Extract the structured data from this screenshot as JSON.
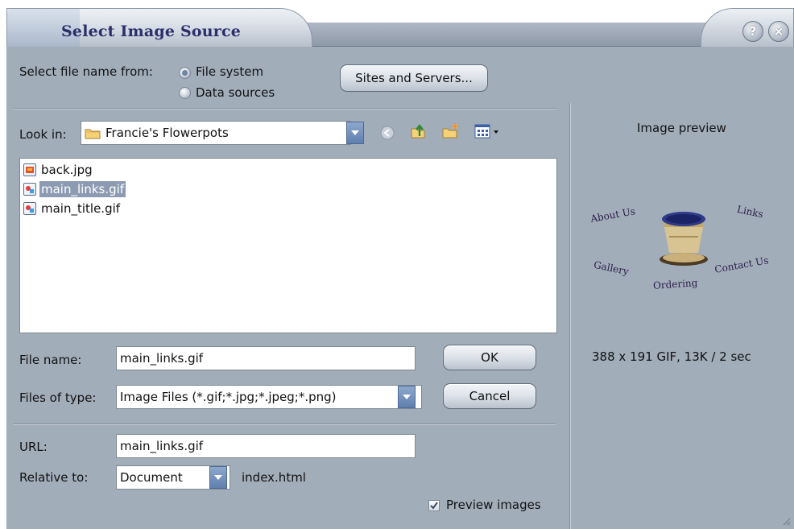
{
  "window": {
    "title": "Select Image Source",
    "help_icon": "question-icon",
    "close_icon": "close-icon"
  },
  "source": {
    "label": "Select file name from:",
    "options": [
      "File system",
      "Data sources"
    ],
    "selected": "File system",
    "sites_button": "Sites and Servers..."
  },
  "lookin": {
    "label": "Look in:",
    "value": "Francie's Flowerpots"
  },
  "files": [
    {
      "name": "back.jpg",
      "icon": "jpg-file-icon",
      "selected": false
    },
    {
      "name": "main_links.gif",
      "icon": "gif-file-icon",
      "selected": true
    },
    {
      "name": "main_title.gif",
      "icon": "gif-file-icon",
      "selected": false
    }
  ],
  "filename": {
    "label": "File name:",
    "value": "main_links.gif",
    "ok_button": "OK"
  },
  "filetype": {
    "label": "Files of type:",
    "value": "Image Files (*.gif;*.jpg;*.jpeg;*.png)",
    "cancel_button": "Cancel"
  },
  "url": {
    "label": "URL:",
    "value": "main_links.gif"
  },
  "relative": {
    "label": "Relative to:",
    "value": "Document",
    "file": "index.html"
  },
  "preview_images": {
    "label": "Preview images",
    "checked": true
  },
  "preview": {
    "title": "Image preview",
    "info": "388 x 191 GIF, 13K / 2 sec",
    "image_words": [
      "About Us",
      "Links",
      "Gallery",
      "Contact Us",
      "Ordering"
    ]
  },
  "colors": {
    "dialog_bg": "#a2adba",
    "title_text": "#2a2f6a",
    "selection": "#8d9bb2",
    "dropdown_accent": "#5f7fae"
  }
}
